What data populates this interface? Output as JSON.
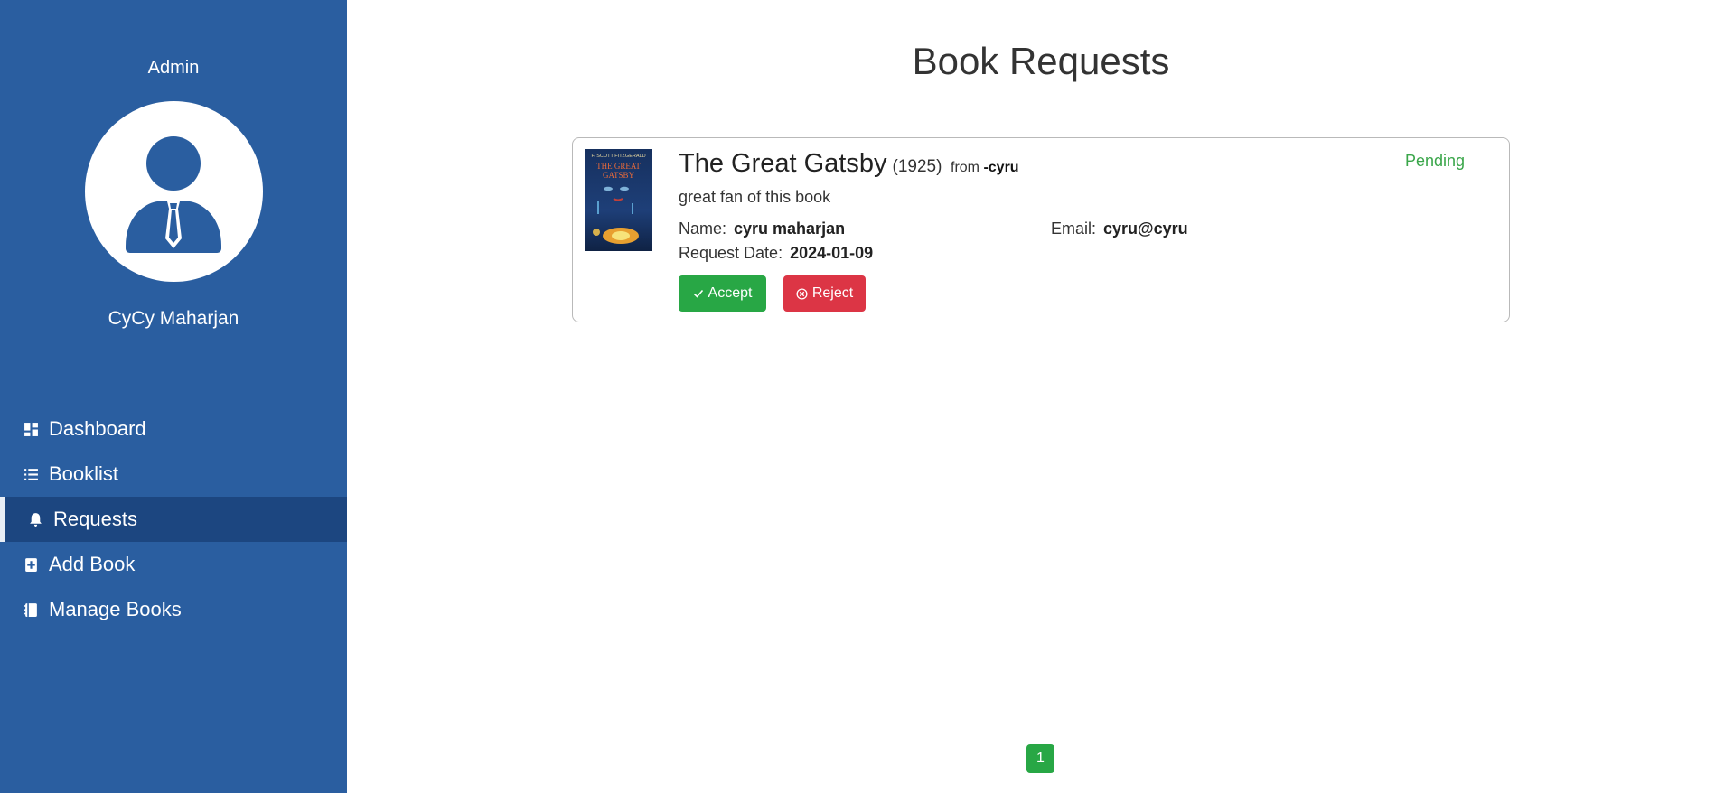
{
  "sidebar": {
    "role": "Admin",
    "username": "CyCy Maharjan",
    "items": [
      {
        "label": "Dashboard",
        "icon": "dashboard-icon"
      },
      {
        "label": "Booklist",
        "icon": "list-icon"
      },
      {
        "label": "Requests",
        "icon": "bell-icon",
        "active": true
      },
      {
        "label": "Add Book",
        "icon": "add-book-icon"
      },
      {
        "label": "Manage Books",
        "icon": "book-icon"
      }
    ]
  },
  "main": {
    "title": "Book Requests",
    "request": {
      "book_title": "The Great Gatsby",
      "year": "(1925)",
      "from_label": "from",
      "from_user": "-cyru",
      "status": "Pending",
      "message": "great fan of this book",
      "name_label": "Name:",
      "name": "cyru maharjan",
      "email_label": "Email:",
      "email": "cyru@cyru",
      "date_label": "Request Date:",
      "date": "2024-01-09",
      "accept_label": "Accept",
      "reject_label": "Reject",
      "cover": {
        "author": "F. SCOTT FITZGERALD",
        "title_line1": "THE GREAT",
        "title_line2": "GATSBY"
      }
    },
    "pagination": {
      "current": "1"
    }
  },
  "colors": {
    "sidebar": "#2a5ea0",
    "sidebar_active": "#1c4680",
    "accept": "#28a745",
    "reject": "#dc3545",
    "status": "#3aa64a"
  }
}
